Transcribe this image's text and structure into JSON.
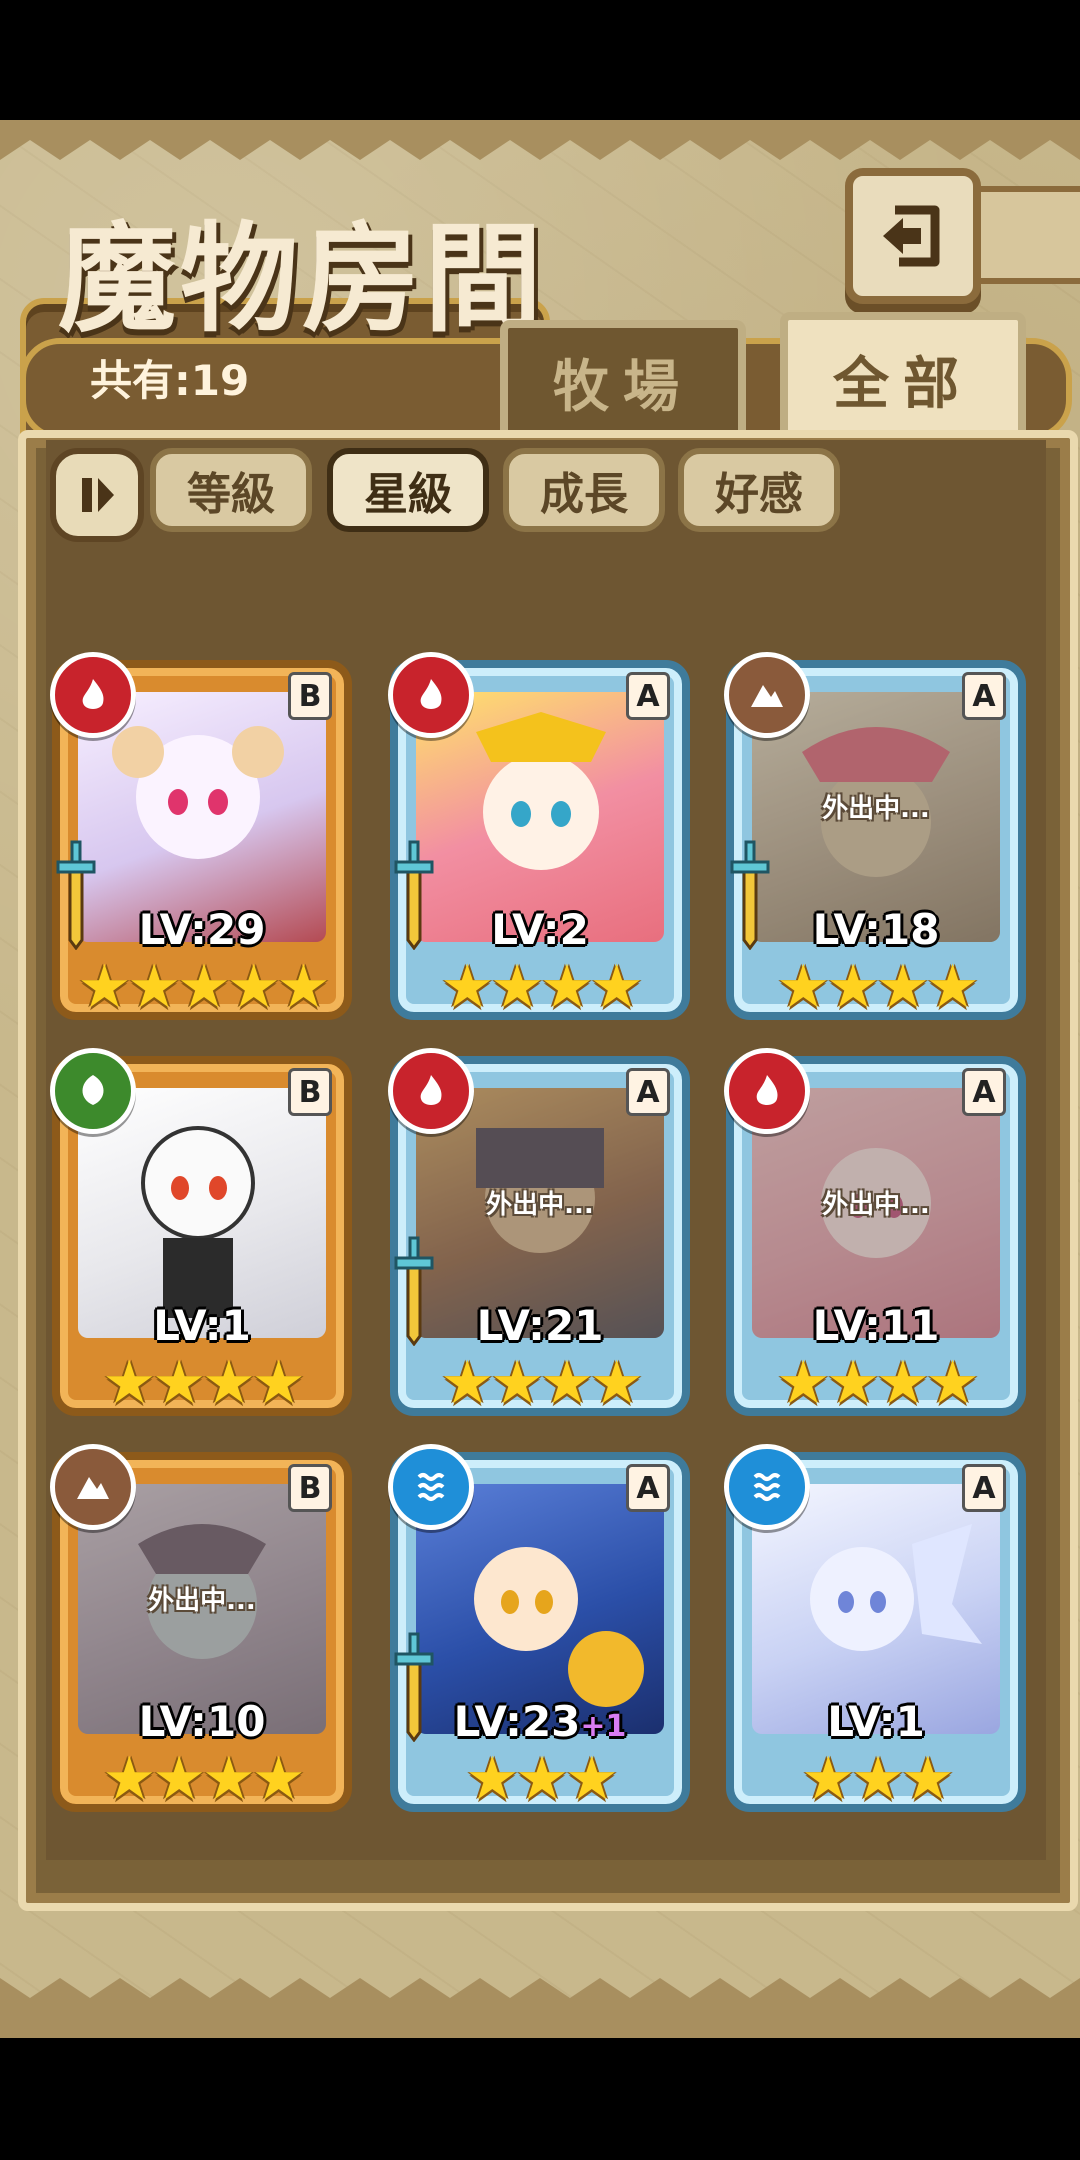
{
  "title": "魔物房間",
  "count_label": "共有:19",
  "tabs": [
    {
      "label": "牧場"
    },
    {
      "label": "全部"
    }
  ],
  "sort_buttons": [
    {
      "label": "等級"
    },
    {
      "label": "星級"
    },
    {
      "label": "成長"
    },
    {
      "label": "好感"
    }
  ],
  "cards": [
    {
      "level": "LV:29",
      "bonus": "",
      "stars": "★★★★★",
      "rank": "B",
      "element": "fire",
      "away": ""
    },
    {
      "level": "LV:2",
      "bonus": "",
      "stars": "★★★★",
      "rank": "A",
      "element": "fire",
      "away": ""
    },
    {
      "level": "LV:18",
      "bonus": "",
      "stars": "★★★★",
      "rank": "A",
      "element": "earth",
      "away": "外出中..."
    },
    {
      "level": "LV:1",
      "bonus": "",
      "stars": "★★★★",
      "rank": "B",
      "element": "leaf",
      "away": ""
    },
    {
      "level": "LV:21",
      "bonus": "",
      "stars": "★★★★",
      "rank": "A",
      "element": "fire",
      "away": "外出中..."
    },
    {
      "level": "LV:11",
      "bonus": "",
      "stars": "★★★★",
      "rank": "A",
      "element": "fire",
      "away": "外出中..."
    },
    {
      "level": "LV:10",
      "bonus": "",
      "stars": "★★★★",
      "rank": "B",
      "element": "earth",
      "away": "外出中..."
    },
    {
      "level": "LV:23",
      "bonus": "+1",
      "stars": "★★★",
      "rank": "A",
      "element": "water",
      "away": ""
    },
    {
      "level": "LV:1",
      "bonus": "",
      "stars": "★★★",
      "rank": "A",
      "element": "water",
      "away": ""
    }
  ]
}
